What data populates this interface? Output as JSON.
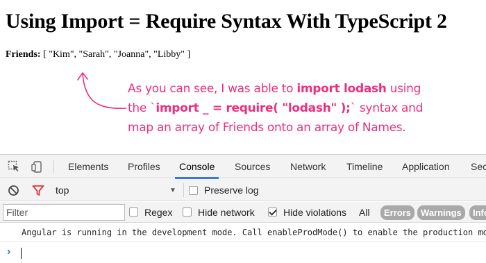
{
  "page": {
    "title": "Using Import = Require Syntax With TypeScript 2",
    "friends_label": "Friends:",
    "friends_value": "[ \"Kim\", \"Sarah\", \"Joanna\", \"Libby\" ]"
  },
  "annotation": {
    "line1_a": "As you can see, I was able to ",
    "line1_b": "import lodash",
    "line1_c": " using",
    "line2_a": "the `",
    "line2_b": "import _ = require( \"lodash\" );",
    "line2_c": "` syntax and",
    "line3": "map an array of Friends onto an array of Names."
  },
  "devtools": {
    "tabs": [
      "Elements",
      "Profiles",
      "Console",
      "Sources",
      "Network",
      "Timeline",
      "Application",
      "Sec"
    ],
    "active_tab": "Console",
    "context": "top",
    "preserve_log": "Preserve log",
    "filter_placeholder": "Filter",
    "regex": "Regex",
    "hide_network": "Hide network",
    "hide_violations": "Hide violations",
    "all": "All",
    "levels": [
      "Errors",
      "Warnings",
      "Info"
    ],
    "console_message": "Angular is running in the development mode. Call enableProdMode() to enable the production mode."
  },
  "colors": {
    "annotation": "#ec2f7e",
    "active_tab_underline": "#3879d9",
    "filter_icon": "#e0343a"
  },
  "icons": [
    "inspect-element-icon",
    "device-toolbar-icon",
    "clear-console-icon",
    "filter-icon",
    "prompt-chevron-icon"
  ]
}
